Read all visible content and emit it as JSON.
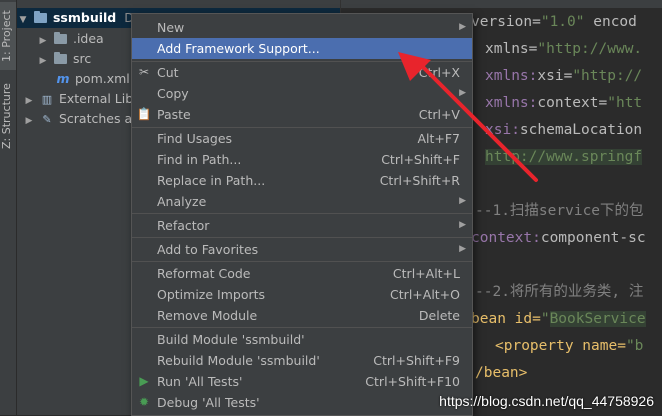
{
  "toolstrip": {
    "project_tab": "1: Project",
    "structure_tab": "Z: Structure"
  },
  "project_tree": {
    "root_label": "ssmbuild",
    "root_path": "D:\\",
    "items": [
      {
        "label": ".idea",
        "kind": "folder"
      },
      {
        "label": "src",
        "kind": "folder"
      },
      {
        "label": "pom.xml",
        "kind": "maven-file"
      },
      {
        "label": "External Libraries",
        "kind": "libraries"
      },
      {
        "label": "Scratches and Consoles",
        "kind": "scratches"
      }
    ]
  },
  "editor": {
    "line1": {
      "a": "version=",
      "b": "\"1.0\"",
      "c": " encod"
    },
    "line2": {
      "a": "xmlns=",
      "b": "\"http://www."
    },
    "line3": {
      "ns": "xmlns:",
      "a": "xsi=",
      "b": "\"http://"
    },
    "line4": {
      "ns": "xmlns:",
      "a": "context=",
      "b": "\"htt"
    },
    "line5": {
      "ns": "xsi:",
      "a": "schemaLocation"
    },
    "line6": {
      "b": "http://www.springf"
    },
    "line7": {
      "comment": "--1.扫描service下的包"
    },
    "line8": {
      "ns": "context:",
      "a": "component-sc"
    },
    "line9": {
      "comment": "--2.将所有的业务类, 注"
    },
    "line10": {
      "a": "bean id=",
      "b": "\"",
      "hl": "BookService"
    },
    "line11": {
      "a": "<property name=",
      "b": "\"b"
    },
    "line12": {
      "a": "/bean>"
    }
  },
  "context_menu": {
    "items": [
      {
        "label": "New",
        "shortcut": "",
        "submenu": true,
        "icon": ""
      },
      {
        "label": "Add Framework Support...",
        "shortcut": "",
        "submenu": false,
        "icon": ""
      },
      {
        "label": "Cut",
        "shortcut": "Ctrl+X",
        "submenu": false,
        "icon": "scissors-icon"
      },
      {
        "label": "Copy",
        "shortcut": "",
        "submenu": true,
        "icon": ""
      },
      {
        "label": "Paste",
        "shortcut": "Ctrl+V",
        "submenu": false,
        "icon": "clipboard-icon"
      },
      {
        "label": "Find Usages",
        "shortcut": "Alt+F7",
        "submenu": false,
        "icon": ""
      },
      {
        "label": "Find in Path...",
        "shortcut": "Ctrl+Shift+F",
        "submenu": false,
        "icon": ""
      },
      {
        "label": "Replace in Path...",
        "shortcut": "Ctrl+Shift+R",
        "submenu": false,
        "icon": ""
      },
      {
        "label": "Analyze",
        "shortcut": "",
        "submenu": true,
        "icon": ""
      },
      {
        "label": "Refactor",
        "shortcut": "",
        "submenu": true,
        "icon": ""
      },
      {
        "label": "Add to Favorites",
        "shortcut": "",
        "submenu": true,
        "icon": ""
      },
      {
        "label": "Reformat Code",
        "shortcut": "Ctrl+Alt+L",
        "submenu": false,
        "icon": ""
      },
      {
        "label": "Optimize Imports",
        "shortcut": "Ctrl+Alt+O",
        "submenu": false,
        "icon": ""
      },
      {
        "label": "Remove Module",
        "shortcut": "Delete",
        "submenu": false,
        "icon": ""
      },
      {
        "label": "Build Module 'ssmbuild'",
        "shortcut": "",
        "submenu": false,
        "icon": ""
      },
      {
        "label": "Rebuild Module 'ssmbuild'",
        "shortcut": "Ctrl+Shift+F9",
        "submenu": false,
        "icon": ""
      },
      {
        "label": "Run 'All Tests'",
        "shortcut": "Ctrl+Shift+F10",
        "submenu": false,
        "icon": "run-icon"
      },
      {
        "label": "Debug 'All Tests'",
        "shortcut": "",
        "submenu": false,
        "icon": "debug-icon"
      }
    ]
  },
  "colors": {
    "menu_highlight": "#4b6eaf",
    "annotation_arrow": "#e8242c"
  },
  "watermark": "https://blog.csdn.net/qq_44758926"
}
